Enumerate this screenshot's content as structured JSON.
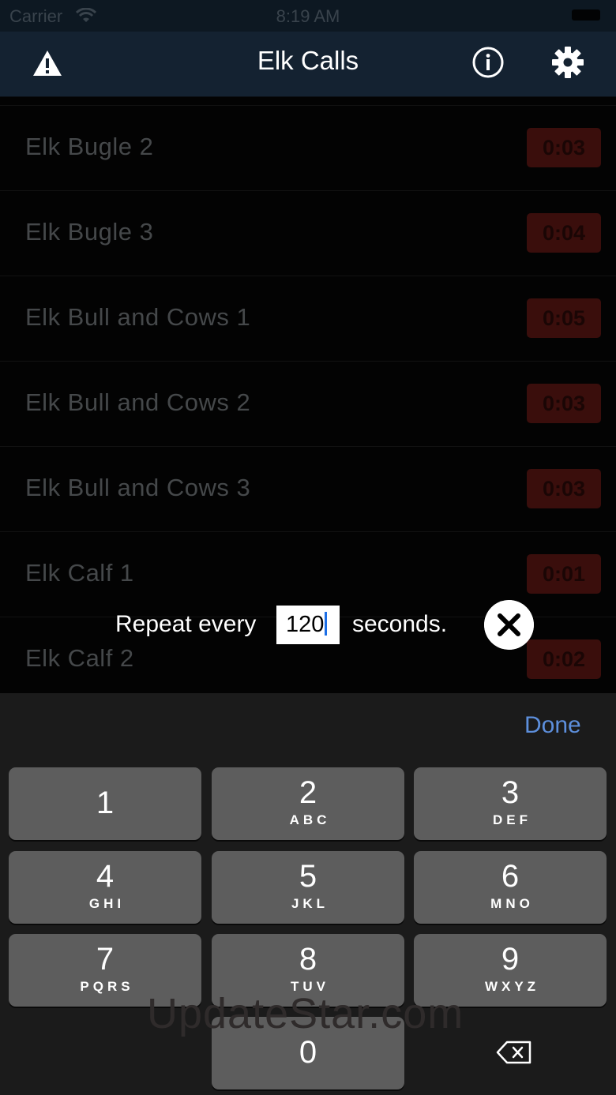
{
  "status_bar": {
    "carrier": "Carrier",
    "time": "8:19 AM"
  },
  "nav": {
    "title": "Elk Calls"
  },
  "calls": [
    {
      "name": "Elk Bugle 2",
      "duration": "0:03"
    },
    {
      "name": "Elk Bugle 3",
      "duration": "0:04"
    },
    {
      "name": "Elk Bull and Cows 1",
      "duration": "0:05"
    },
    {
      "name": "Elk Bull and Cows 2",
      "duration": "0:03"
    },
    {
      "name": "Elk Bull and Cows 3",
      "duration": "0:03"
    },
    {
      "name": "Elk Calf 1",
      "duration": "0:01"
    },
    {
      "name": "Elk Calf 2",
      "duration": "0:02"
    }
  ],
  "repeat": {
    "prefix": "Repeat every",
    "value": "120",
    "suffix": "seconds."
  },
  "keyboard": {
    "done_label": "Done",
    "keys": [
      {
        "digit": "1",
        "letters": ""
      },
      {
        "digit": "2",
        "letters": "ABC"
      },
      {
        "digit": "3",
        "letters": "DEF"
      },
      {
        "digit": "4",
        "letters": "GHI"
      },
      {
        "digit": "5",
        "letters": "JKL"
      },
      {
        "digit": "6",
        "letters": "MNO"
      },
      {
        "digit": "7",
        "letters": "PQRS"
      },
      {
        "digit": "8",
        "letters": "TUV"
      },
      {
        "digit": "9",
        "letters": "WXYZ"
      },
      {
        "digit": "0",
        "letters": ""
      }
    ]
  },
  "watermark": "UpdateStar.com",
  "colors": {
    "nav_background": "#142231",
    "badge_background": "#3a0e0c",
    "done_blue": "#5d8fdc",
    "caret_blue": "#1d6fe6"
  }
}
